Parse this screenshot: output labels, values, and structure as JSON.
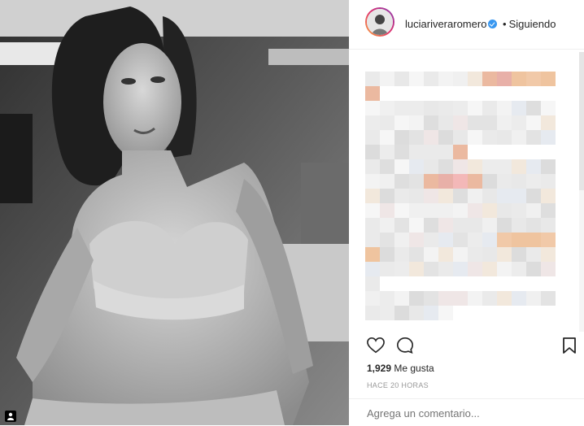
{
  "post": {
    "username": "luciariveraromero",
    "verified_badge": "verified-icon",
    "separator": "•",
    "follow_status": "Siguiendo",
    "likes_count": "1,929",
    "likes_label": "Me gusta",
    "timestamp": "HACE 20 HORAS",
    "comment_placeholder": "Agrega un comentario..."
  },
  "icons": {
    "like": "heart-icon",
    "comment": "comment-icon",
    "save": "bookmark-icon",
    "tag": "user-tag-icon"
  },
  "colors": {
    "verified": "#3897f0",
    "text": "#262626",
    "muted": "#999999",
    "border": "#efefef"
  }
}
